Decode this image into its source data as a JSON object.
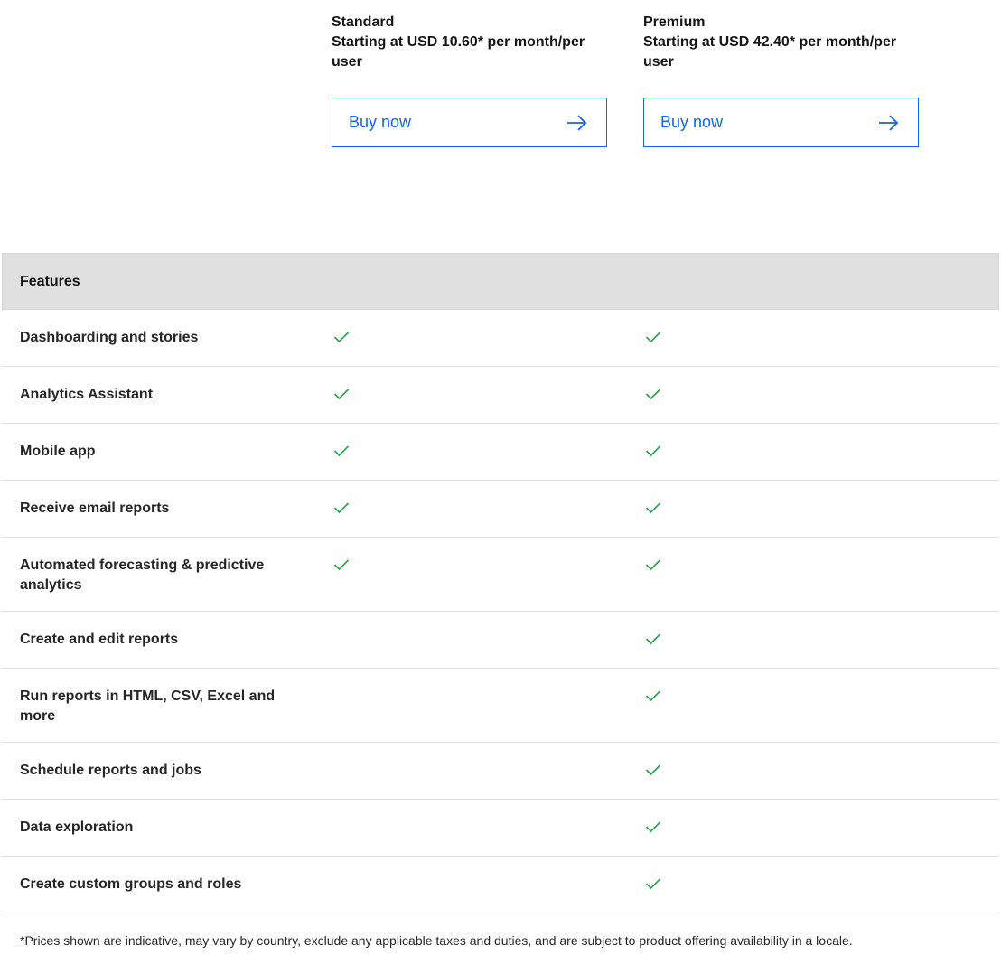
{
  "plans": [
    {
      "name": "Standard",
      "price": "Starting at USD 10.60* per month/per user",
      "button_label": "Buy now",
      "icon": "arrow-right-icon"
    },
    {
      "name": "Premium",
      "price": "Starting at USD 42.40* per month/per user",
      "button_label": "Buy now",
      "icon": "arrow-right-icon"
    }
  ],
  "table": {
    "header": "Features",
    "rows": [
      {
        "label": "Dashboarding and stories",
        "standard": true,
        "premium": true
      },
      {
        "label": "Analytics Assistant",
        "standard": true,
        "premium": true
      },
      {
        "label": "Mobile app",
        "standard": true,
        "premium": true
      },
      {
        "label": "Receive email reports",
        "standard": true,
        "premium": true
      },
      {
        "label": "Automated forecasting & predictive analytics",
        "standard": true,
        "premium": true
      },
      {
        "label": "Create and edit reports",
        "standard": false,
        "premium": true
      },
      {
        "label": "Run reports in HTML, CSV, Excel and more",
        "standard": false,
        "premium": true
      },
      {
        "label": "Schedule reports and jobs",
        "standard": false,
        "premium": true
      },
      {
        "label": "Data exploration",
        "standard": false,
        "premium": true
      },
      {
        "label": "Create custom groups and roles",
        "standard": false,
        "premium": true
      }
    ]
  },
  "footnote": "*Prices shown are indicative, may vary by country, exclude any applicable taxes and duties, and are subject to product offering availability in a locale.",
  "colors": {
    "accent": "#0f62fe",
    "check": "#24a148",
    "header_bg": "#e0e0e0"
  }
}
